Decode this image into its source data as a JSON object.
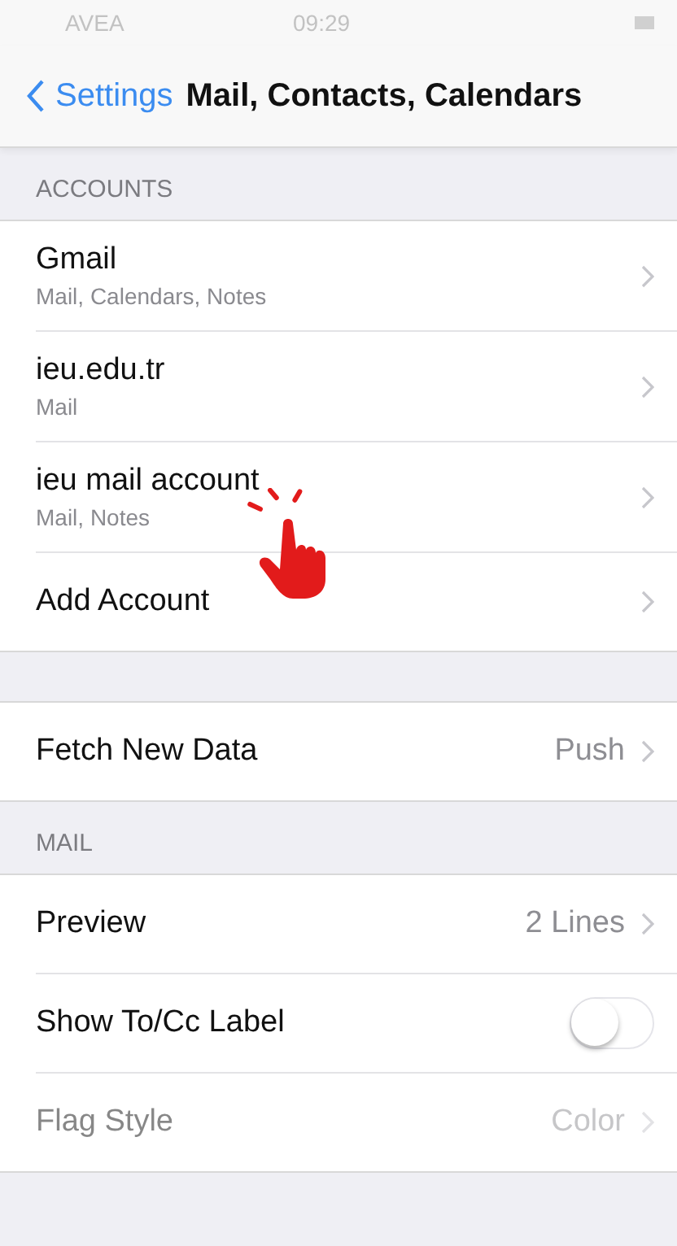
{
  "status_bar": {
    "carrier": "AVEA",
    "time": "09:29"
  },
  "nav": {
    "back": "Settings",
    "title": "Mail, Contacts, Calendars"
  },
  "sections": [
    {
      "header": "ACCOUNTS",
      "rows": [
        {
          "kind": "link",
          "title": "Gmail",
          "subtitle": "Mail, Calendars, Notes"
        },
        {
          "kind": "link",
          "title": "ieu.edu.tr",
          "subtitle": "Mail"
        },
        {
          "kind": "link",
          "title": "ieu mail account",
          "subtitle": "Mail, Notes",
          "tapped": true
        },
        {
          "kind": "link",
          "title": "Add Account"
        }
      ]
    },
    {
      "rows": [
        {
          "kind": "link",
          "title": "Fetch New Data",
          "value": "Push"
        }
      ]
    },
    {
      "header": "MAIL",
      "rows": [
        {
          "kind": "link",
          "title": "Preview",
          "value": "2 Lines"
        },
        {
          "kind": "toggle",
          "title": "Show To/Cc Label",
          "on": false
        },
        {
          "kind": "link",
          "title": "Flag Style",
          "value": "Color",
          "faded": true
        }
      ]
    }
  ]
}
